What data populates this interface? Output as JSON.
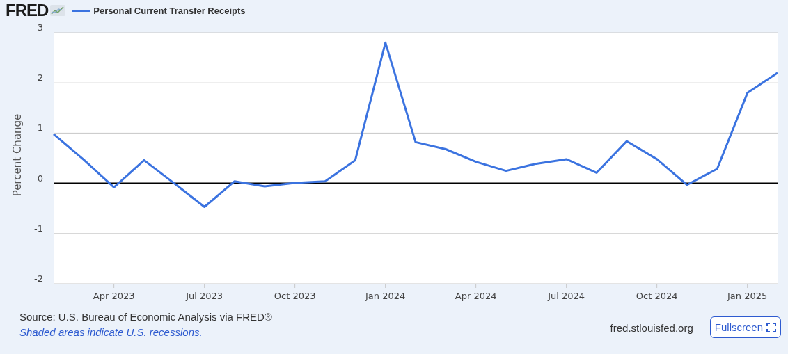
{
  "header": {
    "logo_text": "FRED"
  },
  "chart": {
    "chart_data": {
      "type": "line",
      "ylabel": "Percent Change",
      "grid": true,
      "x": [
        "2023-02",
        "2023-03",
        "2023-04",
        "2023-05",
        "2023-06",
        "2023-07",
        "2023-08",
        "2023-09",
        "2023-10",
        "2023-11",
        "2023-12",
        "2024-01",
        "2024-02",
        "2024-03",
        "2024-04",
        "2024-05",
        "2024-06",
        "2024-07",
        "2024-08",
        "2024-09",
        "2024-10",
        "2024-11",
        "2024-12",
        "2025-01",
        "2025-02"
      ],
      "series": [
        {
          "name": "Personal Current Transfer Receipts",
          "color": "#3b73e0",
          "values": [
            0.98,
            0.47,
            -0.08,
            0.46,
            0.0,
            -0.47,
            0.04,
            -0.06,
            0.01,
            0.04,
            0.46,
            2.8,
            0.82,
            0.68,
            0.43,
            0.25,
            0.39,
            0.48,
            0.21,
            0.84,
            0.48,
            -0.03,
            0.29,
            1.8,
            2.2
          ]
        }
      ],
      "xlim": [
        "2023-02",
        "2025-02"
      ],
      "ylim": [
        -2,
        3
      ],
      "yticks": [
        -2,
        -1,
        0,
        1,
        2,
        3
      ],
      "xticks": [
        {
          "value": "2023-04",
          "label": "Apr 2023"
        },
        {
          "value": "2023-07",
          "label": "Jul 2023"
        },
        {
          "value": "2023-10",
          "label": "Oct 2023"
        },
        {
          "value": "2024-01",
          "label": "Jan 2024"
        },
        {
          "value": "2024-04",
          "label": "Apr 2024"
        },
        {
          "value": "2024-07",
          "label": "Jul 2024"
        },
        {
          "value": "2024-10",
          "label": "Oct 2024"
        },
        {
          "value": "2025-01",
          "label": "Jan 2025"
        }
      ]
    }
  },
  "footer": {
    "source": "Source: U.S. Bureau of Economic Analysis via FRED®",
    "note": "Shaded areas indicate U.S. recessions.",
    "site": "fred.stlouisfed.org",
    "fullscreen_button": "Fullscreen"
  }
}
